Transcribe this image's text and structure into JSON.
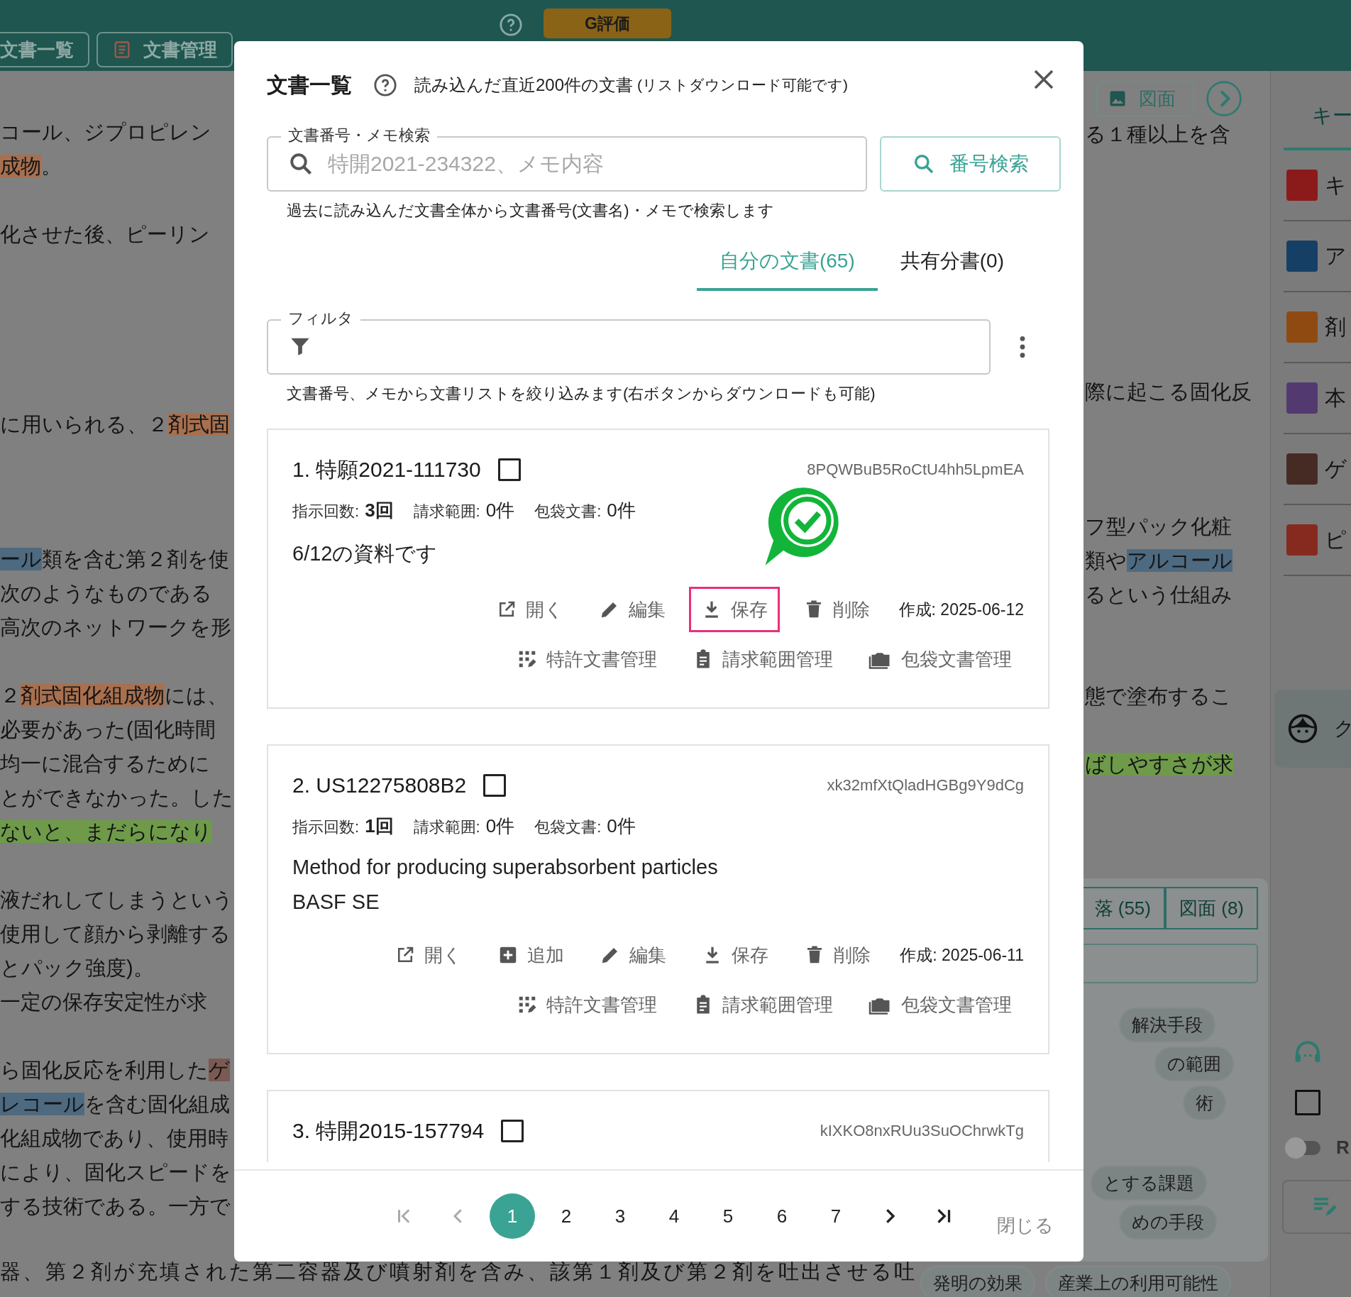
{
  "topbar": {
    "tabs": [
      {
        "label": "文書一覧",
        "kind": "plain"
      },
      {
        "label": "文書管理",
        "kind": "doc"
      }
    ],
    "grade_button": "G評価"
  },
  "left_paragraphs": [
    [
      [
        {
          "text": "コール、ジプロピレン"
        }
      ],
      [
        {
          "text": "成物",
          "color": "#a8704f"
        },
        {
          "text": "。"
        }
      ]
    ],
    [
      [
        {
          "text": "化させた後、ピーリン"
        }
      ]
    ],
    [
      [
        {
          "text": "に用いられる、２"
        },
        {
          "text": "剤式固",
          "color": "#a8704f"
        }
      ]
    ],
    [
      [
        {
          "text": "ール",
          "color": "#4e6a80"
        },
        {
          "text": "類を含む第２剤を使"
        }
      ],
      [
        {
          "text": "次のようなものである"
        }
      ],
      [
        {
          "text": "高次のネットワークを形"
        }
      ]
    ],
    [
      [
        {
          "text": "２"
        },
        {
          "text": "剤式固化組成物",
          "color": "#a8704f"
        },
        {
          "text": "には、"
        }
      ],
      [
        {
          "text": "必要があった(固化時間"
        }
      ],
      [
        {
          "text": "均一に混合するために"
        }
      ],
      [
        {
          "text": "とができなかった。した"
        }
      ],
      [
        {
          "text": "ないと、まだらになり",
          "color": "#6e9a4a"
        }
      ]
    ],
    [
      [
        {
          "text": "液だれしてしまうという"
        }
      ],
      [
        {
          "text": "使用して顔から剥離する"
        }
      ],
      [
        {
          "text": "とパック強度)。"
        }
      ],
      [
        {
          "text": "一定の保存安定性が求"
        }
      ]
    ],
    [
      [
        {
          "text": "ら固化反応を利用した"
        },
        {
          "text": "ゲ",
          "color": "#7a5a52"
        }
      ],
      [
        {
          "text": "レコール",
          "color": "#4e6a80"
        },
        {
          "text": "を含む固化組成"
        }
      ],
      [
        {
          "text": "化組成物であり、使用時"
        }
      ],
      [
        {
          "text": "により、固化スピードを"
        }
      ],
      [
        {
          "text": "する技術である。一方で"
        }
      ]
    ]
  ],
  "bottom_line": "器、第２剤が充填された第二容器及び噴射剤を含み、該第１剤及び第２剤を吐出させる吐",
  "doc_toolbar": {
    "drawing_button": "図面"
  },
  "right_paragraphs": [
    [
      [
        {
          "text": "る１種以上を含"
        }
      ]
    ],
    [
      [
        {
          "text": "際に起こる固化反"
        }
      ]
    ],
    [
      [
        {
          "text": "フ型パック化粧"
        }
      ],
      [
        {
          "text": "類や"
        },
        {
          "text": "アルコール",
          "color": "#4e6a80"
        }
      ],
      [
        {
          "text": "るという仕組み"
        }
      ]
    ],
    [
      [
        {
          "text": "態で塗布するこ"
        }
      ]
    ],
    [
      [
        {
          "text": "ばしやすさが求",
          "color": "#6e9a4a"
        }
      ]
    ]
  ],
  "chip_panel": {
    "tabs": [
      "落 (55)",
      "図面 (8)"
    ],
    "chips": [
      "解決手段",
      "の範囲",
      "術",
      "とする課題",
      "めの手段"
    ],
    "bottom_chips": [
      "発明の効果",
      "産業上の利用可能性"
    ]
  },
  "right_panel": {
    "tab": "キー",
    "keywords": [
      {
        "text": "キ",
        "color": "#8b1a1a"
      },
      {
        "text": "ア",
        "color": "#163f66"
      },
      {
        "text": "剤",
        "color": "#8f4a12"
      },
      {
        "text": "本",
        "color": "#523a70"
      },
      {
        "text": "ゲ",
        "color": "#462b25"
      },
      {
        "text": "ピ",
        "color": "#862a20"
      }
    ],
    "card_text": "ク",
    "checked": false,
    "toggle_on": false,
    "toggle_label": "R"
  },
  "modal": {
    "title": "文書一覧",
    "subtitle": "読み込んだ直近200件の文書",
    "subtitle_note": "(リストダウンロード可能です)",
    "search": {
      "label": "文書番号・メモ検索",
      "placeholder": "特開2021-234322、メモ内容",
      "helper": "過去に読み込んだ文書全体から文書番号(文書名)・メモで検索します",
      "button": "番号検索"
    },
    "tabs": [
      {
        "label": "自分の文書(65)",
        "selected": true
      },
      {
        "label": "共有分書(0)",
        "selected": false
      }
    ],
    "filter": {
      "label": "フィルタ",
      "helper": "文書番号、メモから文書リストを絞り込みます(右ボタンからダウンロードも可能)"
    },
    "documents": [
      {
        "number": "1.",
        "name": "特願2021-111730",
        "checked": false,
        "id": "8PQWBuB5RoCtU4hh5LpmEA",
        "badge": true,
        "stats": [
          {
            "label": "指示回数:",
            "value": "3回",
            "bold": true
          },
          {
            "label": "請求範囲:",
            "value": "0件",
            "bold": false
          },
          {
            "label": "包袋文書:",
            "value": "0件",
            "bold": false
          }
        ],
        "memo": [
          "6/12の資料です"
        ],
        "actions": [
          {
            "kind": "open",
            "label": "開く",
            "highlighted": false
          },
          {
            "kind": "edit",
            "label": "編集",
            "highlighted": false
          },
          {
            "kind": "save",
            "label": "保存",
            "highlighted": true
          },
          {
            "kind": "delete",
            "label": "削除",
            "highlighted": false
          }
        ],
        "created": "作成: 2025-06-12",
        "manage": [
          {
            "kind": "patent",
            "label": "特許文書管理"
          },
          {
            "kind": "claims",
            "label": "請求範囲管理"
          },
          {
            "kind": "folder",
            "label": "包袋文書管理"
          }
        ]
      },
      {
        "number": "2.",
        "name": "US12275808B2",
        "checked": false,
        "id": "xk32mfXtQladHGBg9Y9dCg",
        "badge": false,
        "stats": [
          {
            "label": "指示回数:",
            "value": "1回",
            "bold": true
          },
          {
            "label": "請求範囲:",
            "value": "0件",
            "bold": false
          },
          {
            "label": "包袋文書:",
            "value": "0件",
            "bold": false
          }
        ],
        "memo": [
          "Method for producing superabsorbent particles",
          "BASF SE"
        ],
        "actions": [
          {
            "kind": "open",
            "label": "開く",
            "highlighted": false
          },
          {
            "kind": "add",
            "label": "追加",
            "highlighted": false
          },
          {
            "kind": "edit",
            "label": "編集",
            "highlighted": false
          },
          {
            "kind": "save",
            "label": "保存",
            "highlighted": false
          },
          {
            "kind": "delete",
            "label": "削除",
            "highlighted": false
          }
        ],
        "created": "作成: 2025-06-11",
        "manage": [
          {
            "kind": "patent",
            "label": "特許文書管理"
          },
          {
            "kind": "claims",
            "label": "請求範囲管理"
          },
          {
            "kind": "folder",
            "label": "包袋文書管理"
          }
        ]
      },
      {
        "number": "3.",
        "name": "特開2015-157794",
        "checked": false,
        "id": "kIXKO8nxRUu3SuOChrwkTg",
        "badge": false
      }
    ],
    "pagination": [
      {
        "kind": "first"
      },
      {
        "kind": "prev"
      },
      {
        "kind": "page",
        "label": "1",
        "selected": true
      },
      {
        "kind": "page",
        "label": "2",
        "selected": false
      },
      {
        "kind": "page",
        "label": "3",
        "selected": false
      },
      {
        "kind": "page",
        "label": "4",
        "selected": false
      },
      {
        "kind": "page",
        "label": "5",
        "selected": false
      },
      {
        "kind": "page",
        "label": "6",
        "selected": false
      },
      {
        "kind": "page",
        "label": "7",
        "selected": false
      },
      {
        "kind": "next"
      },
      {
        "kind": "last"
      }
    ],
    "close_button": "閉じる"
  }
}
